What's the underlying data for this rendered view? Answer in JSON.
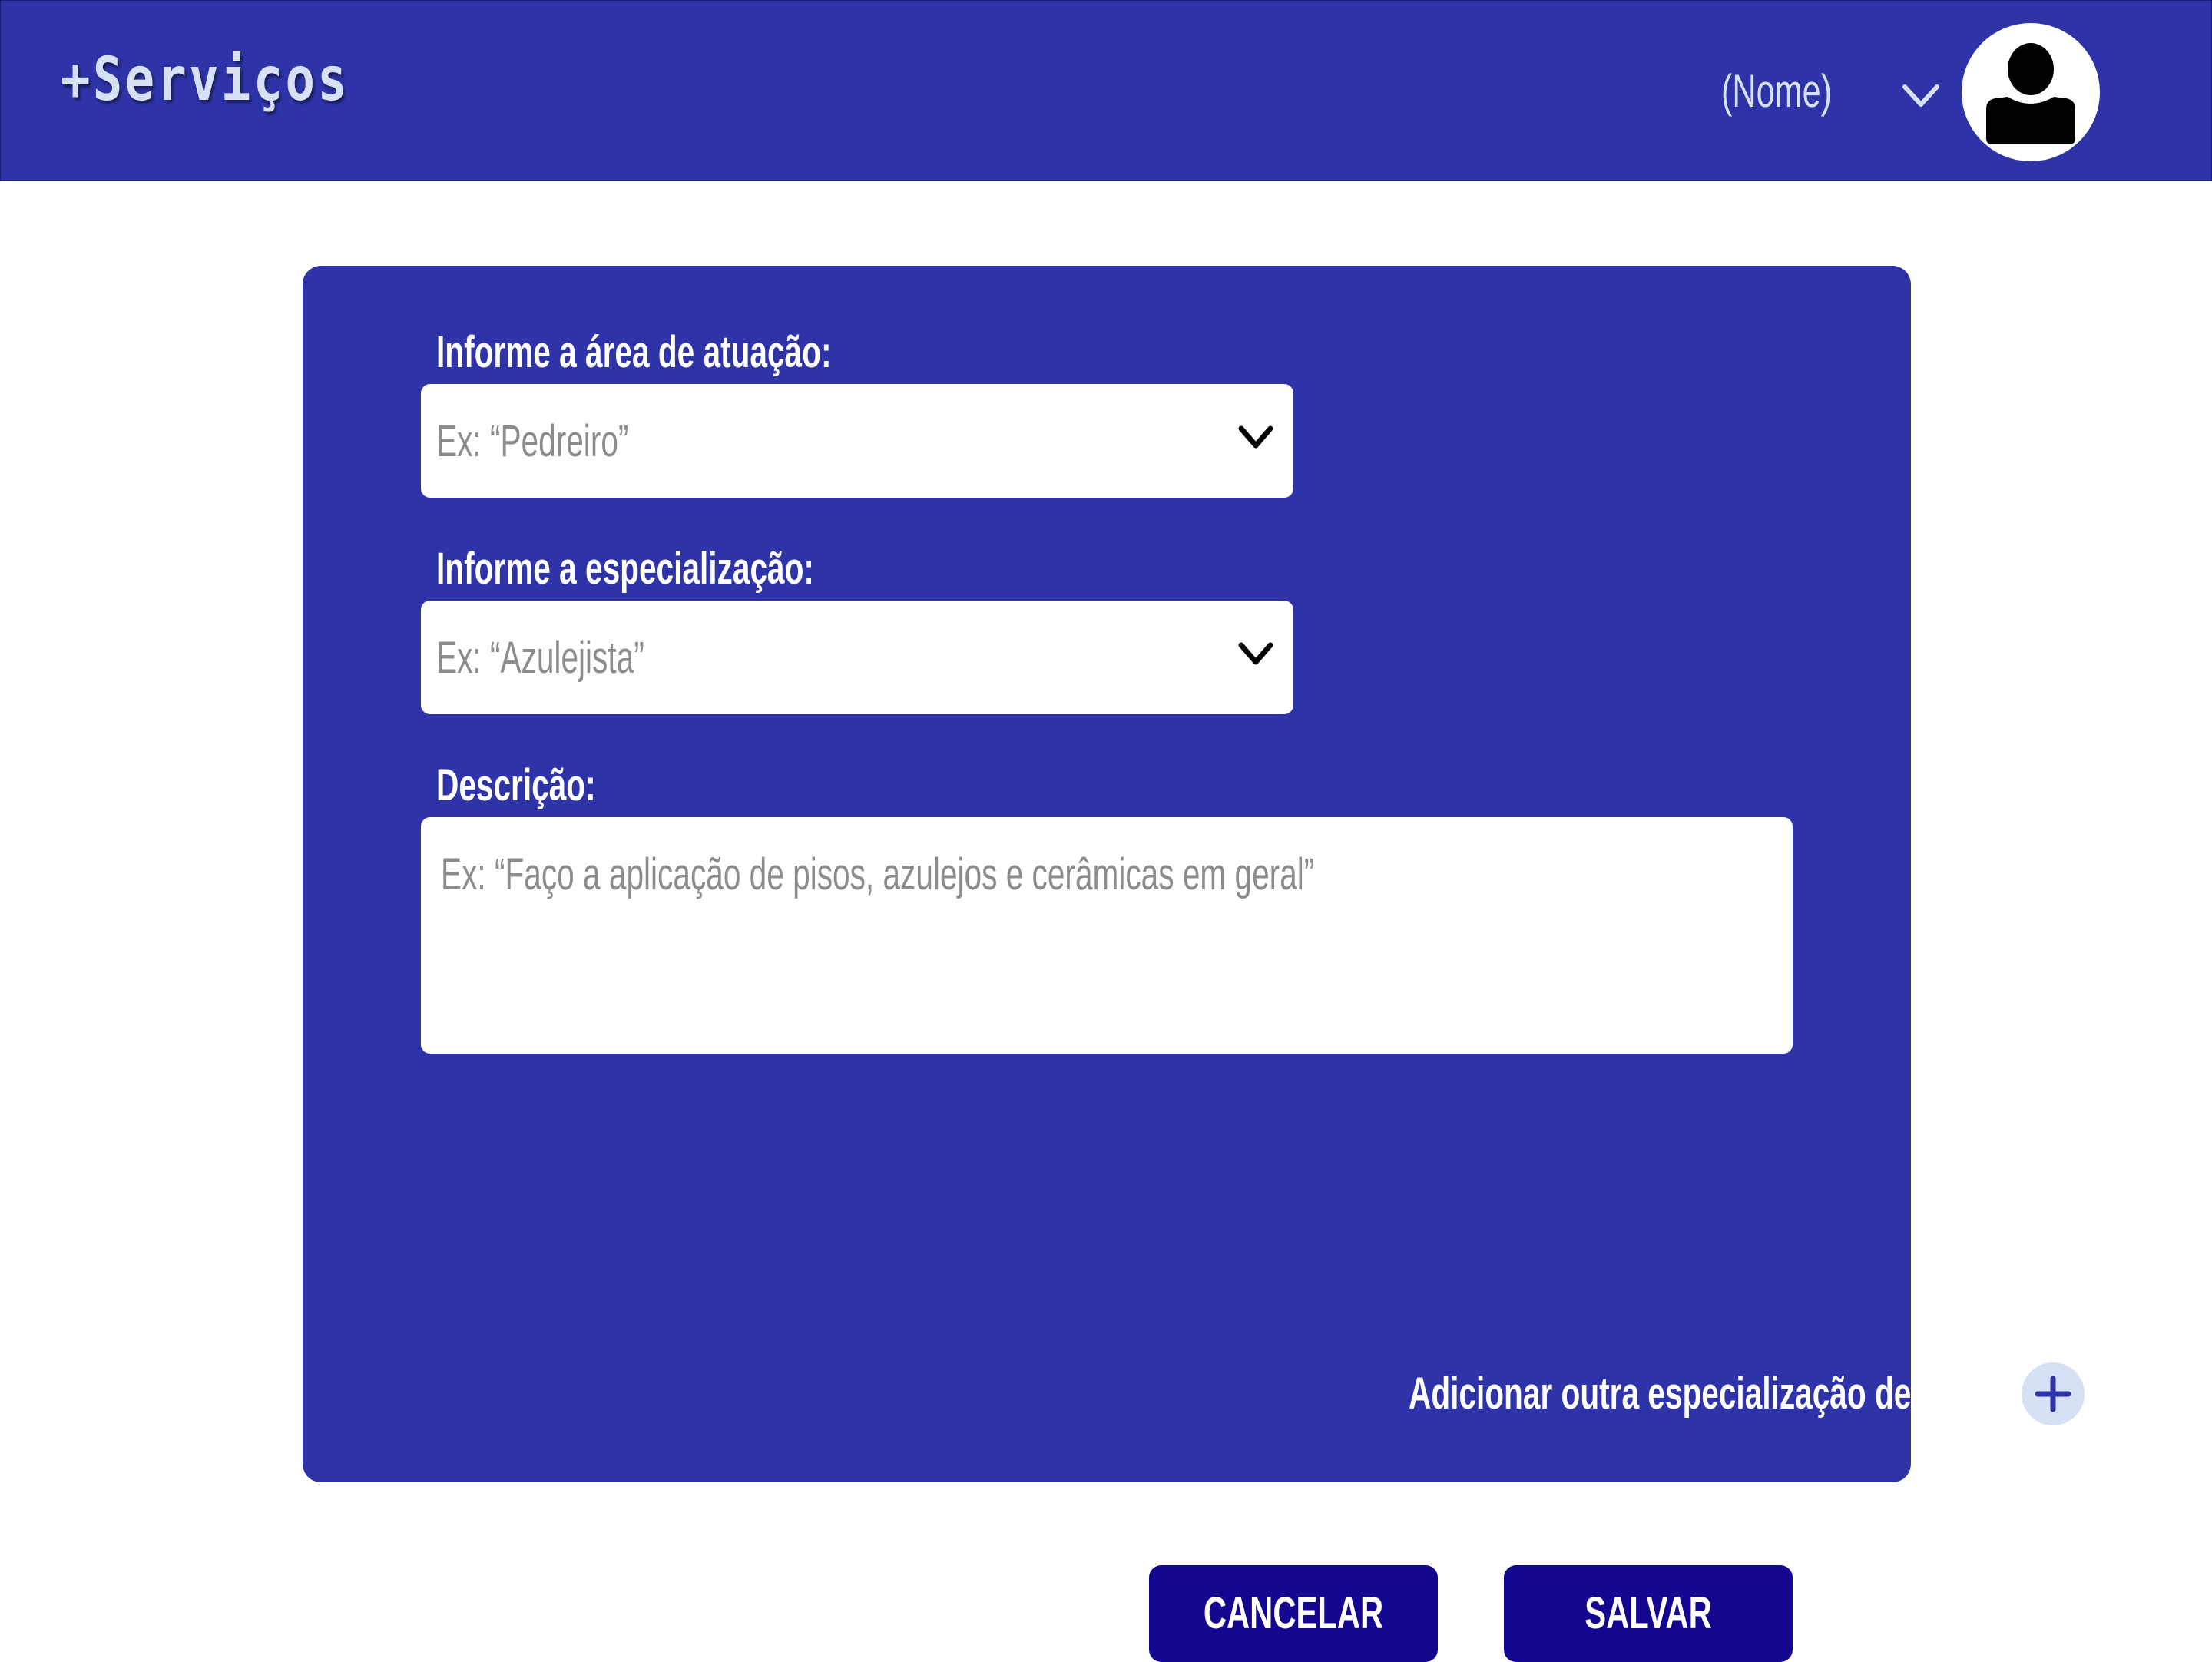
{
  "header": {
    "brand": "+Serviços",
    "user_name": "(Nome)",
    "user_menu_icon": "chevron-down-icon",
    "avatar_icon": "user-icon"
  },
  "form": {
    "area": {
      "label": "Informe a área de atuação:",
      "placeholder": "Ex: “Pedreiro”"
    },
    "specialization": {
      "label": "Informe a especialização:",
      "placeholder": "Ex: “Azulejista”"
    },
    "description": {
      "label": "Descrição:",
      "placeholder": "Ex: “Faço a aplicação de pisos, azulejos e cerâmicas em geral”"
    },
    "add_specialization_label": "Adicionar outra especialização de serviço",
    "add_icon": "plus-icon",
    "cancel_label": "CANCELAR",
    "save_label": "SALVAR"
  },
  "colors": {
    "header_bg": "#2e34a8",
    "card_bg": "#2e34a8",
    "button_bg": "#14078f",
    "accent_light": "#d7e1f5",
    "placeholder": "#8c8c8c"
  }
}
